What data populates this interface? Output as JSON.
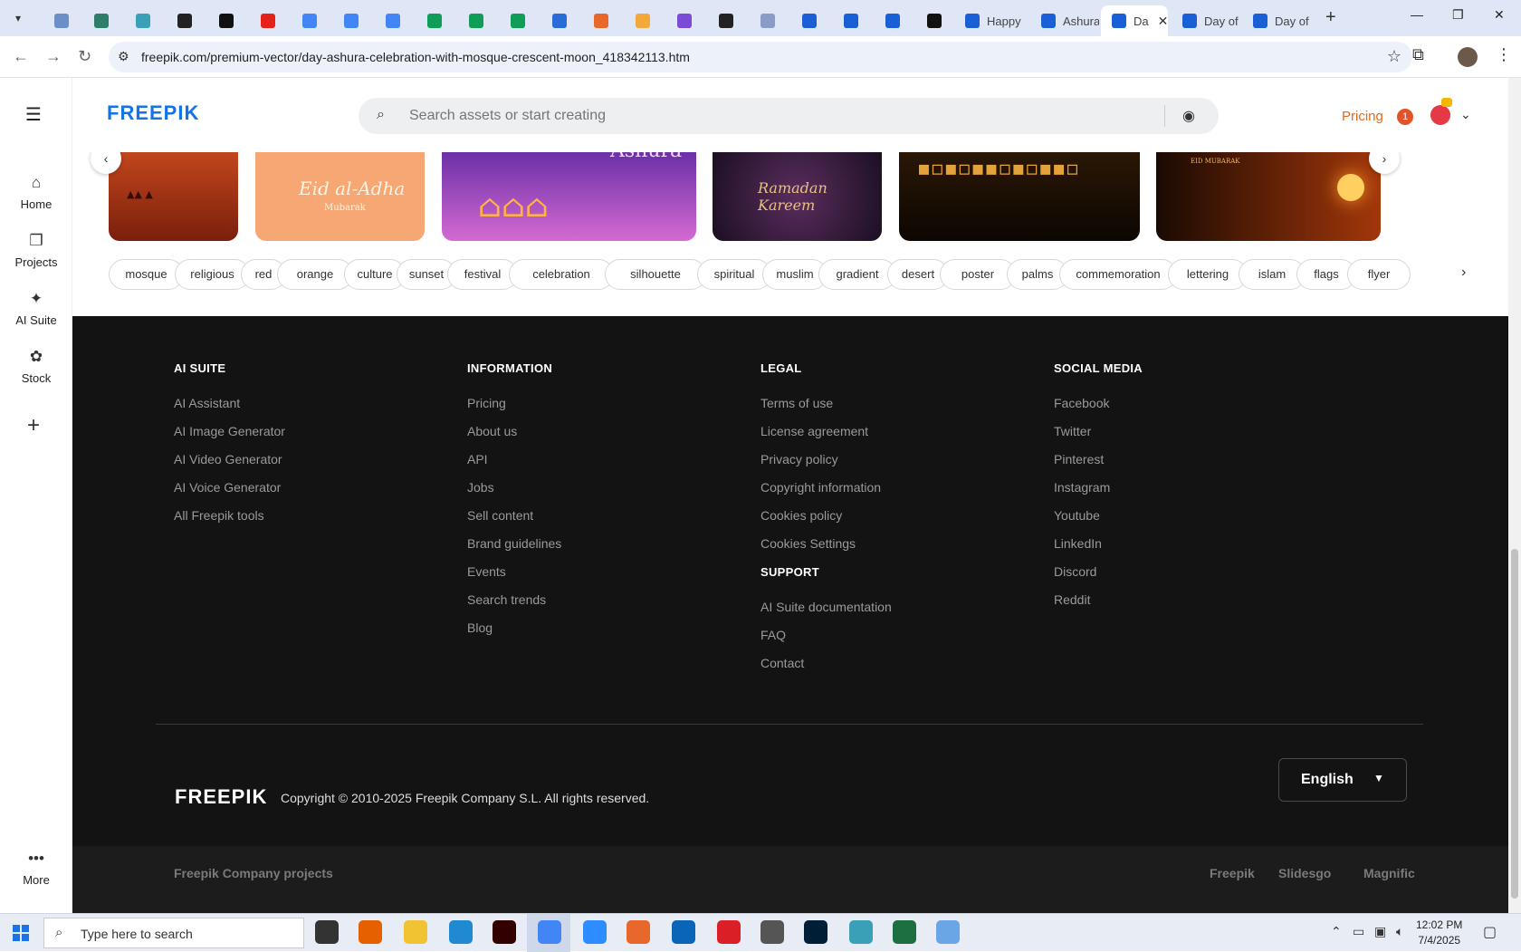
{
  "browser": {
    "tabs": [
      {
        "title": "",
        "color": "#6b8fc6"
      },
      {
        "title": "",
        "color": "#2e7d6b"
      },
      {
        "title": "",
        "color": "#3aa0b7"
      },
      {
        "title": "",
        "color": "#222222"
      },
      {
        "title": "",
        "color": "#111111"
      },
      {
        "title": "",
        "color": "#e62117"
      },
      {
        "title": "",
        "color": "#4285f4"
      },
      {
        "title": "",
        "color": "#4285f4"
      },
      {
        "title": "",
        "color": "#4285f4"
      },
      {
        "title": "",
        "color": "#0f9d58"
      },
      {
        "title": "",
        "color": "#0f9d58"
      },
      {
        "title": "",
        "color": "#0f9d58"
      },
      {
        "title": "",
        "color": "#2b6bd8"
      },
      {
        "title": "",
        "color": "#e8672a"
      },
      {
        "title": "",
        "color": "#f3a83c"
      },
      {
        "title": "",
        "color": "#7b4bd8"
      },
      {
        "title": "",
        "color": "#222222"
      },
      {
        "title": "",
        "color": "#8a9bc7"
      },
      {
        "title": "",
        "color": "#1a5fd6"
      },
      {
        "title": "",
        "color": "#1a5fd6"
      },
      {
        "title": "",
        "color": "#1a5fd6"
      },
      {
        "title": "",
        "color": "#111111"
      },
      {
        "title": "Happy",
        "color": "#1a5fd6"
      },
      {
        "title": "Ashura",
        "color": "#1a5fd6"
      },
      {
        "title": "Da",
        "color": "#1a5fd6",
        "active": true
      },
      {
        "title": "Day of",
        "color": "#1a5fd6"
      },
      {
        "title": "Day of",
        "color": "#1a5fd6"
      }
    ],
    "url": "freepik.com/premium-vector/day-ashura-celebration-with-mosque-crescent-moon_418342113.htm"
  },
  "leftnav": {
    "items": [
      {
        "label": "Home",
        "icon": "home-icon"
      },
      {
        "label": "Projects",
        "icon": "projects-icon"
      },
      {
        "label": "AI Suite",
        "icon": "sparkle-icon"
      },
      {
        "label": "Stock",
        "icon": "stock-icon"
      }
    ],
    "more_label": "More"
  },
  "header": {
    "logo": "FREEPIK",
    "search_placeholder": "Search assets or start creating",
    "pricing": "Pricing",
    "notification_count": "1"
  },
  "thumbnails": [
    {
      "caption": "",
      "bg": "linear-gradient(180deg,#c1461c,#7a1f0c)"
    },
    {
      "caption": "Eid al-Adha",
      "sub": "Mubarak",
      "bg": "#f6a773"
    },
    {
      "caption": "Ashura",
      "bg": "linear-gradient(180deg,#6b2fa8,#d46ad1)"
    },
    {
      "caption": "Ramadan Kareem",
      "bg": "radial-gradient(circle at 50% 50%,#5a2d5e,#1b0f22)"
    },
    {
      "caption": "",
      "bg": "linear-gradient(180deg,#2a1705,#0c0602)"
    },
    {
      "caption": "EID MUBARAK",
      "bg": "linear-gradient(90deg,#1a0a02,#a3360a)"
    }
  ],
  "tags": [
    "mosque",
    "religious",
    "red",
    "orange",
    "culture",
    "sunset",
    "festival",
    "celebration",
    "silhouette",
    "spiritual",
    "muslim",
    "gradient",
    "desert",
    "poster",
    "palms",
    "commemoration",
    "lettering",
    "islam",
    "flags",
    "flyer"
  ],
  "footer": {
    "columns": [
      {
        "heading": "AI SUITE",
        "links": [
          "AI Assistant",
          "AI Image Generator",
          "AI Video Generator",
          "AI Voice Generator",
          "All Freepik tools"
        ]
      },
      {
        "heading": "INFORMATION",
        "links": [
          "Pricing",
          "About us",
          "API",
          "Jobs",
          "Sell content",
          "Brand guidelines",
          "Events",
          "Search trends",
          "Blog"
        ]
      },
      {
        "heading": "LEGAL",
        "links": [
          "Terms of use",
          "License agreement",
          "Privacy policy",
          "Copyright information",
          "Cookies policy",
          "Cookies Settings"
        ]
      },
      {
        "heading": "SOCIAL MEDIA",
        "links": [
          "Facebook",
          "Twitter",
          "Pinterest",
          "Instagram",
          "Youtube",
          "LinkedIn",
          "Discord",
          "Reddit"
        ]
      }
    ],
    "support": {
      "heading": "SUPPORT",
      "links": [
        "AI Suite documentation",
        "FAQ",
        "Contact"
      ]
    },
    "logo": "FREEPIK",
    "copyright": "Copyright © 2010-2025 Freepik Company S.L. All rights reserved.",
    "language": "English"
  },
  "subfooter": {
    "label": "Freepik Company projects",
    "links": [
      "Freepik",
      "Slidesgo",
      "Magnific"
    ]
  },
  "taskbar": {
    "search_text": "Type here to search",
    "apps": [
      {
        "name": "task-view",
        "color": "#333333"
      },
      {
        "name": "firefox",
        "color": "#e66000"
      },
      {
        "name": "file-explorer",
        "color": "#f1c232"
      },
      {
        "name": "vscode",
        "color": "#1f8ad2"
      },
      {
        "name": "illustrator",
        "color": "#330000"
      },
      {
        "name": "chrome",
        "color": "#4285f4"
      },
      {
        "name": "zoom",
        "color": "#2d8cff"
      },
      {
        "name": "app-orange",
        "color": "#e8672a"
      },
      {
        "name": "outlook",
        "color": "#0a64b7"
      },
      {
        "name": "creative-cloud",
        "color": "#da1f26"
      },
      {
        "name": "pen-tool",
        "color": "#555555"
      },
      {
        "name": "photoshop",
        "color": "#001e36"
      },
      {
        "name": "app-teal",
        "color": "#3aa0b7"
      },
      {
        "name": "excel",
        "color": "#1d6f42"
      },
      {
        "name": "notepad",
        "color": "#6aa6e6"
      }
    ],
    "time": "12:02 PM",
    "date": "7/4/2025"
  }
}
